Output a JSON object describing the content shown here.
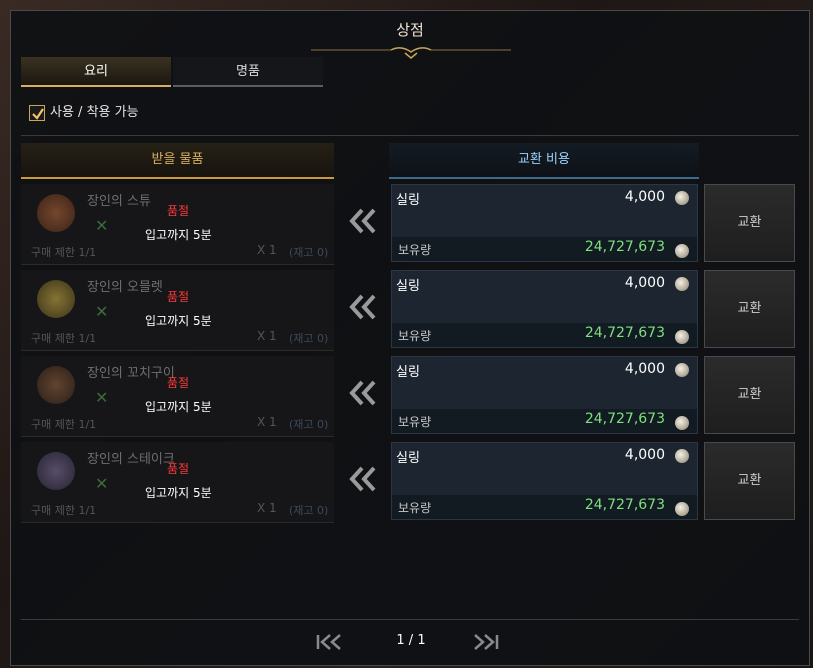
{
  "window": {
    "title": "상점"
  },
  "tabs": [
    {
      "label": "요리",
      "active": true
    },
    {
      "label": "명품",
      "active": false
    }
  ],
  "filter": {
    "label": "사용 / 착용 가능",
    "checked": true
  },
  "columns": {
    "receive": "받을 물품",
    "cost": "교환 비용"
  },
  "items": [
    {
      "name": "장인의 스튜",
      "status": "품절",
      "restock": "입고까지 5분",
      "limit": "구매 제한 1/1",
      "qty": "X 1",
      "stock": "(재고 0)",
      "currency": "실링",
      "price": "4,000",
      "held_label": "보유량",
      "held_amount": "24,727,673",
      "button": "교환",
      "icon": "stew-dish-icon",
      "icon_color": "#a0522d"
    },
    {
      "name": "장인의 오믈렛",
      "status": "품절",
      "restock": "입고까지 5분",
      "limit": "구매 제한 1/1",
      "qty": "X 1",
      "stock": "(재고 0)",
      "currency": "실링",
      "price": "4,000",
      "held_label": "보유량",
      "held_amount": "24,727,673",
      "button": "교환",
      "icon": "omelet-dish-icon",
      "icon_color": "#d4b43a"
    },
    {
      "name": "장인의 꼬치구이",
      "status": "품절",
      "restock": "입고까지 5분",
      "limit": "구매 제한 1/1",
      "qty": "X 1",
      "stock": "(재고 0)",
      "currency": "실링",
      "price": "4,000",
      "held_label": "보유량",
      "held_amount": "24,727,673",
      "button": "교환",
      "icon": "skewer-dish-icon",
      "icon_color": "#8a5a3a"
    },
    {
      "name": "장인의 스테이크",
      "status": "품절",
      "restock": "입고까지 5분",
      "limit": "구매 제한 1/1",
      "qty": "X 1",
      "stock": "(재고 0)",
      "currency": "실링",
      "price": "4,000",
      "held_label": "보유량",
      "held_amount": "24,727,673",
      "button": "교환",
      "icon": "steak-dish-icon",
      "icon_color": "#7a6a9a"
    }
  ],
  "pagination": {
    "text": "1 / 1"
  },
  "colors": {
    "accent_gold": "#d6b060",
    "sold_out": "#ff3a3a",
    "held_amount": "#7ee17e",
    "cost_header": "#9fd2ff"
  }
}
